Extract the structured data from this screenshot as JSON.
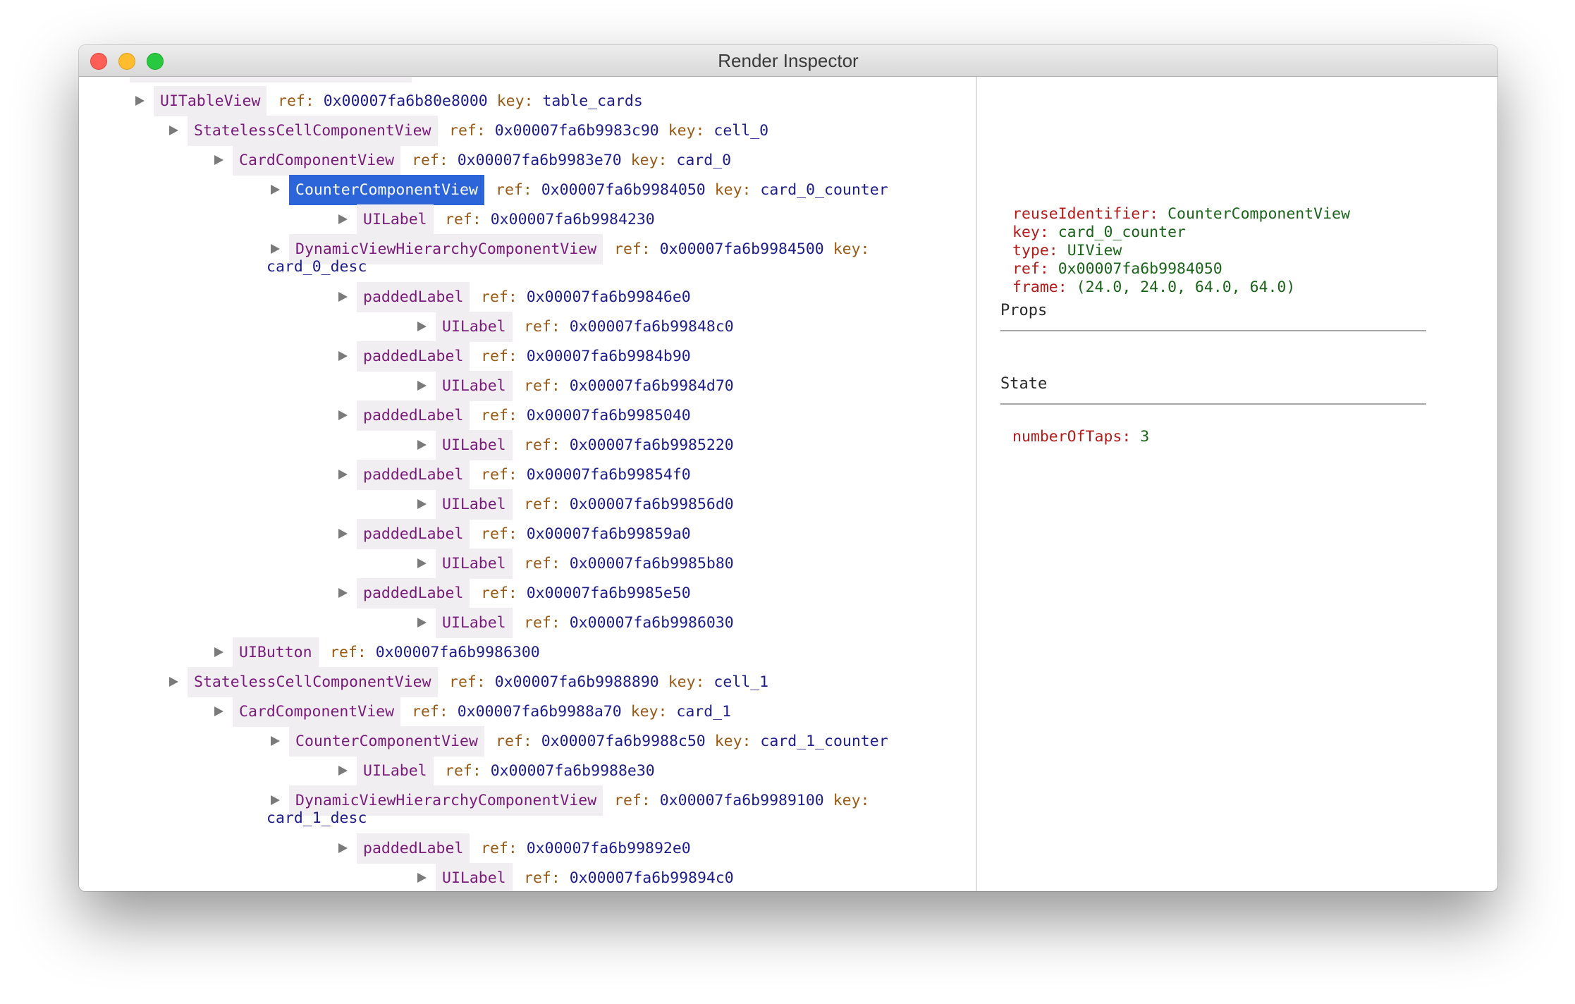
{
  "window": {
    "title": "Render Inspector"
  },
  "tree": [
    {
      "name": "UITableView",
      "depth": 1,
      "ref": "0x00007fa6b80e8000",
      "key": "table_cards"
    },
    {
      "name": "StatelessCellComponentView",
      "depth": 2,
      "ref": "0x00007fa6b9983c90",
      "key": "cell_0"
    },
    {
      "name": "CardComponentView",
      "depth": 3,
      "ref": "0x00007fa6b9983e70",
      "key": "card_0"
    },
    {
      "name": "CounterComponentView",
      "depth": 4,
      "ref": "0x00007fa6b9984050",
      "key": "card_0_counter",
      "selected": true
    },
    {
      "name": "UILabel",
      "depth": 5,
      "ref": "0x00007fa6b9984230"
    },
    {
      "name": "DynamicViewHierarchyComponentView",
      "depth": 4,
      "ref": "0x00007fa6b9984500",
      "key": "card_0_desc",
      "wrap": true
    },
    {
      "name": "paddedLabel",
      "depth": 5,
      "ref": "0x00007fa6b99846e0"
    },
    {
      "name": "UILabel",
      "depth": 6,
      "ref": "0x00007fa6b99848c0"
    },
    {
      "name": "paddedLabel",
      "depth": 5,
      "ref": "0x00007fa6b9984b90"
    },
    {
      "name": "UILabel",
      "depth": 6,
      "ref": "0x00007fa6b9984d70"
    },
    {
      "name": "paddedLabel",
      "depth": 5,
      "ref": "0x00007fa6b9985040"
    },
    {
      "name": "UILabel",
      "depth": 6,
      "ref": "0x00007fa6b9985220"
    },
    {
      "name": "paddedLabel",
      "depth": 5,
      "ref": "0x00007fa6b99854f0"
    },
    {
      "name": "UILabel",
      "depth": 6,
      "ref": "0x00007fa6b99856d0"
    },
    {
      "name": "paddedLabel",
      "depth": 5,
      "ref": "0x00007fa6b99859a0"
    },
    {
      "name": "UILabel",
      "depth": 6,
      "ref": "0x00007fa6b9985b80"
    },
    {
      "name": "paddedLabel",
      "depth": 5,
      "ref": "0x00007fa6b9985e50"
    },
    {
      "name": "UILabel",
      "depth": 6,
      "ref": "0x00007fa6b9986030"
    },
    {
      "name": "UIButton",
      "depth": 3,
      "ref": "0x00007fa6b9986300"
    },
    {
      "name": "StatelessCellComponentView",
      "depth": 2,
      "ref": "0x00007fa6b9988890",
      "key": "cell_1"
    },
    {
      "name": "CardComponentView",
      "depth": 3,
      "ref": "0x00007fa6b9988a70",
      "key": "card_1"
    },
    {
      "name": "CounterComponentView",
      "depth": 4,
      "ref": "0x00007fa6b9988c50",
      "key": "card_1_counter"
    },
    {
      "name": "UILabel",
      "depth": 5,
      "ref": "0x00007fa6b9988e30"
    },
    {
      "name": "DynamicViewHierarchyComponentView",
      "depth": 4,
      "ref": "0x00007fa6b9989100",
      "key": "card_1_desc",
      "wrap": true
    },
    {
      "name": "paddedLabel",
      "depth": 5,
      "ref": "0x00007fa6b99892e0"
    },
    {
      "name": "UILabel",
      "depth": 6,
      "ref": "0x00007fa6b99894c0"
    }
  ],
  "labels": {
    "ref": "ref:",
    "key": "key:"
  },
  "inspector": {
    "details": [
      {
        "key": "reuseIdentifier:",
        "value": "CounterComponentView"
      },
      {
        "key": "key:",
        "value": "card_0_counter"
      },
      {
        "key": "type:",
        "value": "UIView"
      },
      {
        "key": "ref:",
        "value": "0x00007fa6b9984050"
      },
      {
        "key": "frame:",
        "value": "(24.0, 24.0, 64.0, 64.0)"
      }
    ],
    "props_title": "Props",
    "state_title": "State",
    "state": [
      {
        "key": "numberOfTaps:",
        "value": "3"
      }
    ]
  },
  "colors": {
    "selection": "#2b65d9",
    "node_name": "#7a1a7a",
    "attr_key": "#9b5a14",
    "attr_value": "#1c1c8c",
    "inspector_key": "#b51a1a",
    "inspector_value": "#1a641a"
  }
}
